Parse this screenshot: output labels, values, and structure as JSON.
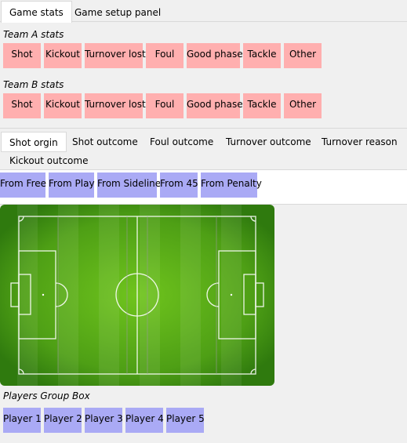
{
  "main_tabs": [
    "Game stats",
    "Game setup panel"
  ],
  "team_a": {
    "title": "Team A stats",
    "buttons": [
      "Shot",
      "Kickout",
      "Turnover lost",
      "Foul",
      "Good phase",
      "Tackle",
      "Other"
    ]
  },
  "team_b": {
    "title": "Team B stats",
    "buttons": [
      "Shot",
      "Kickout",
      "Turnover lost",
      "Foul",
      "Good phase",
      "Tackle",
      "Other"
    ]
  },
  "outcome_tabs": [
    "Shot orgin",
    "Shot outcome",
    "Foul outcome",
    "Turnover outcome",
    "Turnover reason",
    "Kickout outcome"
  ],
  "shot_origin_buttons": [
    "From Free",
    "From Play",
    "From Sideline",
    "From 45",
    "From Penalty"
  ],
  "players": {
    "title": "Players Group Box",
    "buttons": [
      "Player 1",
      "Player 2",
      "Player 3",
      "Player 4",
      "Player 5"
    ]
  },
  "colors": {
    "stat_button": "#ffafaf",
    "origin_button": "#aaaaf5",
    "pitch_dark": "#3f8f16",
    "pitch_light": "#63b819"
  }
}
